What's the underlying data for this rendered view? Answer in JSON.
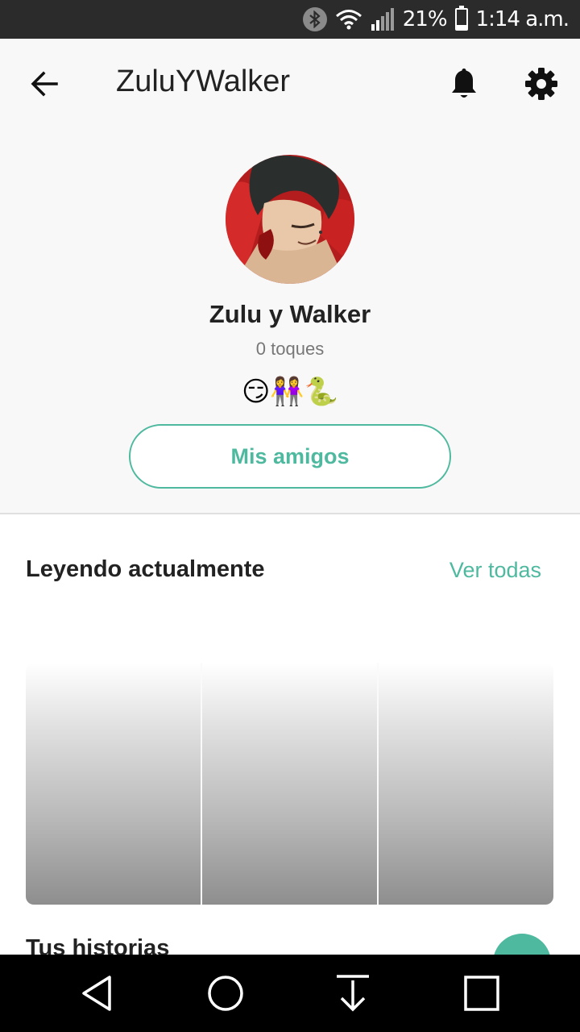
{
  "status_bar": {
    "battery": "21%",
    "battery_level": 0.21,
    "time": "1:14 a.m.",
    "icons": [
      "bluetooth-icon",
      "wifi-icon",
      "signal-icon",
      "battery-icon"
    ]
  },
  "header": {
    "username": "ZuluYWalker",
    "icons": [
      "back-arrow-icon",
      "bell-icon",
      "gear-icon"
    ]
  },
  "profile": {
    "display_name": "Zulu y Walker",
    "touches": "0 toques",
    "emojis": "😏👭🐍",
    "friends_button": "Mis amigos"
  },
  "reading": {
    "title": "Leyendo actualmente",
    "see_all": "Ver todas",
    "books": 3
  },
  "stories": {
    "title": "Tus historias"
  },
  "colors": {
    "accent": "#4fb9a0",
    "status_bar": "#2b2b2b",
    "nav_bar": "#000000"
  }
}
